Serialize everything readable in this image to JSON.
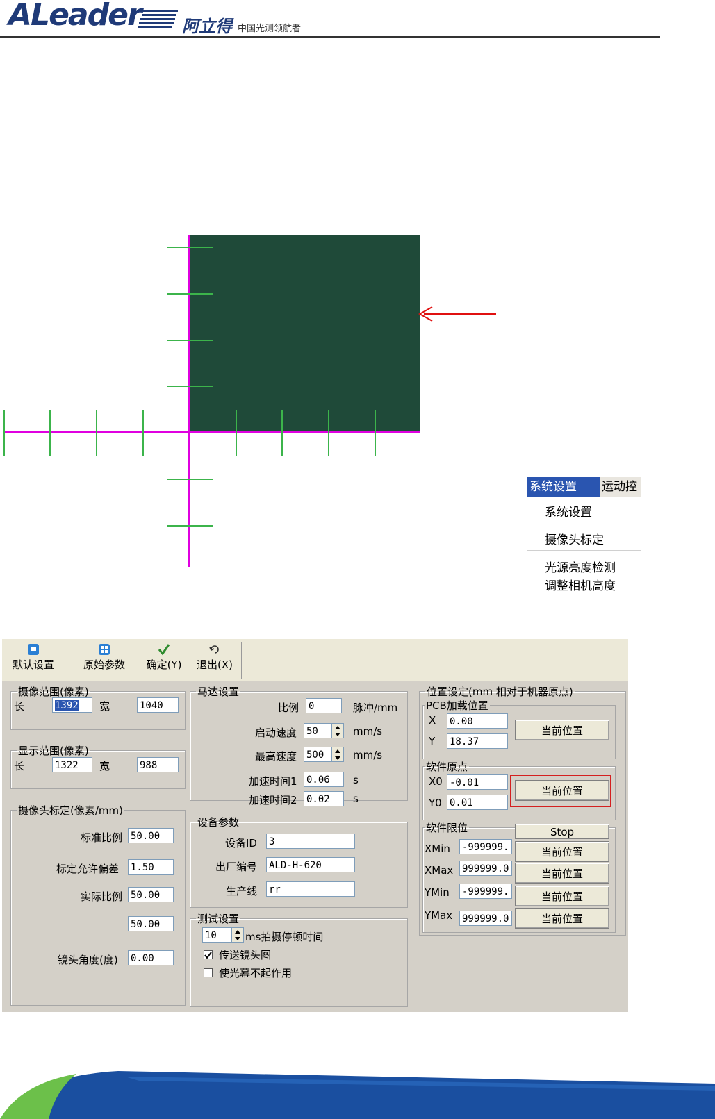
{
  "header": {
    "logo_text": "ALeader",
    "logo_cn": "阿立得",
    "slogan": "中国光测领航者"
  },
  "menu": {
    "bar_active": "系统设置",
    "bar_next": "运动控",
    "items": [
      "系统设置",
      "摄像头标定",
      "光源亮度检测",
      "调整相机高度"
    ]
  },
  "dialog": {
    "toolbar": {
      "default_settings": "默认设置",
      "original_params": "原始参数",
      "confirm": "确定(Y)",
      "exit": "退出(X)"
    },
    "camera_range": {
      "title": "摄像范围(像素)",
      "length_label": "长",
      "length_value": "1392",
      "width_label": "宽",
      "width_value": "1040"
    },
    "display_range": {
      "title": "显示范围(像素)",
      "length_label": "长",
      "length_value": "1322",
      "width_label": "宽",
      "width_value": "988"
    },
    "calibration": {
      "title": "摄像头标定(像素/mm)",
      "standard_ratio_label": "标准比例",
      "standard_ratio_value": "50.00",
      "tolerance_label": "标定允许偏差",
      "tolerance_value": "1.50",
      "actual_ratio_label": "实际比例",
      "actual_ratio_value": "50.00",
      "extra_value": "50.00",
      "lens_angle_label": "镜头角度(度)",
      "lens_angle_value": "0.00"
    },
    "motor": {
      "title": "马达设置",
      "ratio_label": "比例",
      "ratio_value": "0",
      "ratio_unit": "脉冲/mm",
      "start_speed_label": "启动速度",
      "start_speed_value": "50",
      "start_speed_unit": "mm/s",
      "max_speed_label": "最高速度",
      "max_speed_value": "500",
      "max_speed_unit": "mm/s",
      "accel1_label": "加速时间1",
      "accel1_value": "0.06",
      "accel1_unit": "s",
      "accel2_label": "加速时间2",
      "accel2_value": "0.02",
      "accel2_unit": "s"
    },
    "device": {
      "title": "设备参数",
      "id_label": "设备ID",
      "id_value": "3",
      "serial_label": "出厂编号",
      "serial_value": "ALD-H-620",
      "line_label": "生产线",
      "line_value": "rr"
    },
    "test": {
      "title": "测试设置",
      "pause_value": "10",
      "pause_label": "ms拍摄停顿时间",
      "send_image_label": "传送镜头图",
      "send_image_checked": true,
      "disable_curtain_label": "使光幕不起作用",
      "disable_curtain_checked": false
    },
    "position": {
      "title": "位置设定(mm 相对于机器原点)",
      "pcb": {
        "title": "PCB加载位置",
        "x_label": "X",
        "x_value": "0.00",
        "y_label": "Y",
        "y_value": "18.37",
        "button": "当前位置"
      },
      "origin": {
        "title": "软件原点",
        "x0_label": "X0",
        "x0_value": "-0.01",
        "y0_label": "Y0",
        "y0_value": "0.01",
        "button": "当前位置"
      },
      "limits": {
        "title": "软件限位",
        "stop_button": "Stop",
        "xmin_label": "XMin",
        "xmin_value": "-999999.",
        "xmax_label": "XMax",
        "xmax_value": "999999.0",
        "ymin_label": "YMin",
        "ymin_value": "-999999.",
        "ymax_label": "YMax",
        "ymax_value": "999999.0",
        "button": "当前位置"
      }
    }
  },
  "colors": {
    "brand_blue": "#1f3a78",
    "axis_magenta": "#e000e0",
    "tick_green": "#3cb44b",
    "highlight_red": "#d42020",
    "menu_selected": "#2a55b0"
  }
}
